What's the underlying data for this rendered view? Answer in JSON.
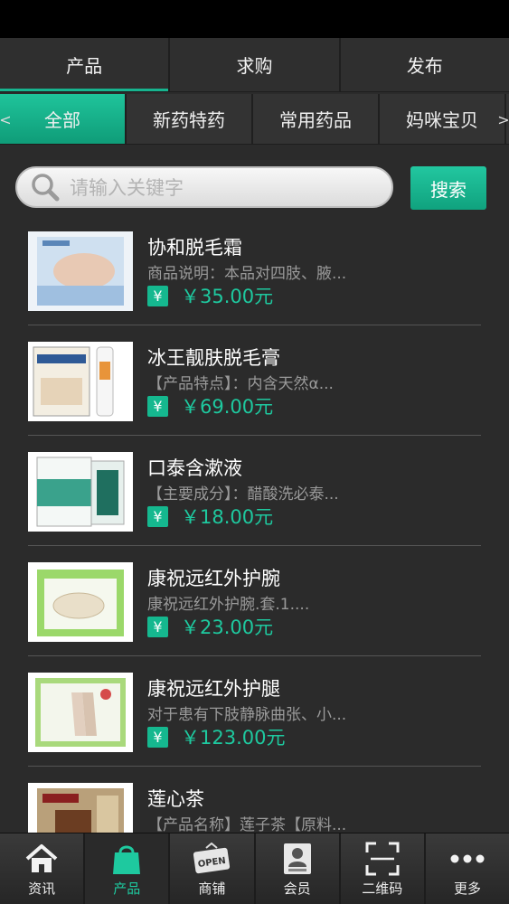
{
  "top_tabs": [
    {
      "label": "产品",
      "active": true
    },
    {
      "label": "求购",
      "active": false
    },
    {
      "label": "发布",
      "active": false
    }
  ],
  "categories": {
    "left_arrow": "<",
    "right_arrow": ">",
    "items": [
      {
        "label": "全部",
        "active": true
      },
      {
        "label": "新药特药",
        "active": false
      },
      {
        "label": "常用药品",
        "active": false
      },
      {
        "label": "妈咪宝贝",
        "active": false
      }
    ]
  },
  "search": {
    "placeholder": "请输入关键字",
    "button_label": "搜索"
  },
  "products": [
    {
      "name": "协和脱毛霜",
      "desc": "商品说明：本品对四肢、腋...",
      "yen": "¥",
      "price": "￥35.00元"
    },
    {
      "name": "冰王靓肤脱毛膏",
      "desc": "【产品特点】：内含天然α...",
      "yen": "¥",
      "price": "￥69.00元"
    },
    {
      "name": "口泰含漱液",
      "desc": "【主要成分】：醋酸洗必泰...",
      "yen": "¥",
      "price": "￥18.00元"
    },
    {
      "name": "康祝远红外护腕",
      "desc": "康祝远红外护腕.套.1....",
      "yen": "¥",
      "price": "￥23.00元"
    },
    {
      "name": "康祝远红外护腿",
      "desc": "对于患有下肢静脉曲张、小...",
      "yen": "¥",
      "price": "￥123.00元"
    },
    {
      "name": "莲心茶",
      "desc": "【产品名称】莲子茶【原料...",
      "yen": "¥",
      "price": ""
    }
  ],
  "bottom_nav": [
    {
      "label": "资讯",
      "icon": "home-icon",
      "active": false
    },
    {
      "label": "产品",
      "icon": "shopping-bag-icon",
      "active": true
    },
    {
      "label": "商铺",
      "icon": "open-sign-icon",
      "active": false
    },
    {
      "label": "会员",
      "icon": "member-card-icon",
      "active": false
    },
    {
      "label": "二维码",
      "icon": "qr-scan-icon",
      "active": false
    },
    {
      "label": "更多",
      "icon": "more-dots-icon",
      "active": false
    }
  ],
  "colors": {
    "accent": "#17b48f",
    "price": "#1ec99f",
    "background": "#2b2b2b"
  }
}
